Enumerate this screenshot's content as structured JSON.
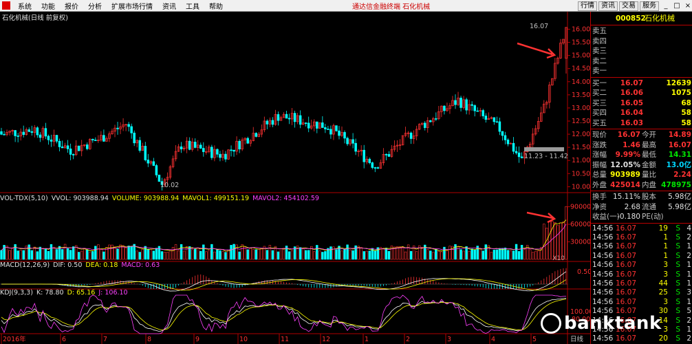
{
  "menu": {
    "items": [
      "系统",
      "功能",
      "报价",
      "分析",
      "扩展市场行情",
      "资讯",
      "工具",
      "帮助"
    ],
    "app_title": "通达信金融终端 石化机械",
    "right_buttons": [
      "行情",
      "资讯",
      "交易",
      "服务"
    ],
    "window_controls": [
      "_",
      "□",
      "×"
    ]
  },
  "main_chart": {
    "title": "石化机械(日线 前复权)",
    "y_ticks": [
      "16.00",
      "15.50",
      "15.00",
      "14.50",
      "14.00",
      "13.50",
      "13.00",
      "12.50",
      "12.00",
      "11.50",
      "11.00",
      "10.50",
      "10.00"
    ],
    "high_label": "16.07",
    "low_label": "10.02",
    "range_label": "11.23 - 11.42",
    "price_range": [
      9.8,
      16.3
    ]
  },
  "vol_chart": {
    "title": "VOL-TDX(5,10)",
    "fields": [
      "VVOL: 903988.94",
      "VOLUME: 903988.94",
      "MAVOL1: 499151.19",
      "MAVOL2: 454102.59"
    ],
    "y_ticks": [
      "90000",
      "60000",
      "30000"
    ],
    "unit": "X10"
  },
  "macd_chart": {
    "title": "MACD(12,26,9)",
    "fields": [
      "DIF: 0.50",
      "DEA: 0.18",
      "MACD: 0.63"
    ],
    "y_ticks": [
      "0.50"
    ]
  },
  "kdj_chart": {
    "title": "KDJ(9,3,3)",
    "fields": [
      "K: 78.80",
      "D: 65.16",
      "J: 106.10"
    ],
    "y_ticks": [
      "100.00",
      "80.00"
    ]
  },
  "x_axis": [
    "2016年",
    "6",
    "7",
    "8",
    "9",
    "10",
    "11",
    "12",
    "1",
    "2",
    "3",
    "4",
    "5"
  ],
  "x_axis_label": "日线",
  "panel": {
    "code": "000852",
    "name": "石化机械",
    "ask_labels": [
      "卖五",
      "卖四",
      "卖三",
      "卖二",
      "卖一"
    ],
    "bids": [
      {
        "label": "买一",
        "price": "16.07",
        "vol": "12639"
      },
      {
        "label": "买二",
        "price": "16.06",
        "vol": "1075"
      },
      {
        "label": "买三",
        "price": "16.05",
        "vol": "68"
      },
      {
        "label": "买四",
        "price": "16.04",
        "vol": "58"
      },
      {
        "label": "买五",
        "price": "16.03",
        "vol": "58"
      }
    ],
    "stats": [
      {
        "l1": "现价",
        "v1": "16.07",
        "c1": "red",
        "l2": "今开",
        "v2": "14.89",
        "c2": "red"
      },
      {
        "l1": "涨跌",
        "v1": "1.46",
        "c1": "red",
        "l2": "最高",
        "v2": "16.07",
        "c2": "red"
      },
      {
        "l1": "涨幅",
        "v1": "9.99%",
        "c1": "red",
        "l2": "最低",
        "v2": "14.31",
        "c2": "green"
      },
      {
        "l1": "振幅",
        "v1": "12.05%",
        "c1": "white",
        "l2": "金额",
        "v2": "13.0亿",
        "c2": "cyan"
      },
      {
        "l1": "总量",
        "v1": "903989",
        "c1": "yellow",
        "l2": "量比",
        "v2": "2.24",
        "c2": "red"
      },
      {
        "l1": "外盘",
        "v1": "425014",
        "c1": "red",
        "l2": "内盘",
        "v2": "478975",
        "c2": "green"
      }
    ],
    "stats2": [
      {
        "l1": "换手",
        "v1": "15.11%",
        "c1": "white",
        "l2": "股本",
        "v2": "5.98亿",
        "c2": "white"
      },
      {
        "l1": "净资",
        "v1": "2.68",
        "c1": "white",
        "l2": "流通",
        "v2": "5.98亿",
        "c2": "white"
      },
      {
        "l1": "收益(一)",
        "v1": "-0.180",
        "c1": "white",
        "l2": "PE(动)",
        "v2": "",
        "c2": "white"
      }
    ],
    "ticks": [
      {
        "time": "14:56",
        "price": "16.07",
        "vol": "19",
        "dir": "S",
        "n": "4"
      },
      {
        "time": "14:56",
        "price": "16.07",
        "vol": "1",
        "dir": "S",
        "n": "2"
      },
      {
        "time": "14:56",
        "price": "16.07",
        "vol": "1",
        "dir": "S",
        "n": "1"
      },
      {
        "time": "14:56",
        "price": "16.07",
        "vol": "1",
        "dir": "S",
        "n": "2"
      },
      {
        "time": "14:56",
        "price": "16.07",
        "vol": "3",
        "dir": "S",
        "n": "1"
      },
      {
        "time": "14:56",
        "price": "16.07",
        "vol": "3",
        "dir": "S",
        "n": "1"
      },
      {
        "time": "14:56",
        "price": "16.07",
        "vol": "44",
        "dir": "S",
        "n": "1"
      },
      {
        "time": "14:56",
        "price": "16.07",
        "vol": "25",
        "dir": "S",
        "n": "3"
      },
      {
        "time": "14:56",
        "price": "16.07",
        "vol": "3",
        "dir": "S",
        "n": "1"
      },
      {
        "time": "14:56",
        "price": "16.07",
        "vol": "30",
        "dir": "S",
        "n": "5"
      },
      {
        "time": "14:56",
        "price": "16.07",
        "vol": "14",
        "dir": "S",
        "n": "2"
      },
      {
        "time": "14:56",
        "price": "16.07",
        "vol": "3",
        "dir": "S",
        "n": "1"
      },
      {
        "time": "14:56",
        "price": "16.07",
        "vol": "20",
        "dir": "S",
        "n": "2"
      }
    ]
  },
  "watermark": "banktank",
  "colors": {
    "up": "#ff3232",
    "down": "#00ffff",
    "grid": "#b00000",
    "ma_white": "#ffffff",
    "ma_yellow": "#ffff00",
    "ma_magenta": "#ff40ff"
  }
}
